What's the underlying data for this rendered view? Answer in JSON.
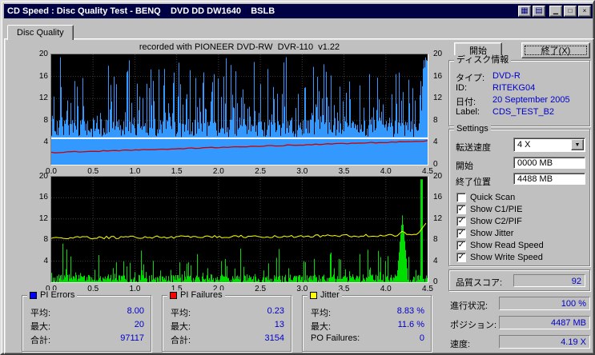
{
  "window": {
    "title": "CD Speed : Disc Quality Test - BENQ    DVD DD DW1640    BSLB",
    "titlebar_buttons": [
      {
        "name": "chart-window-icon-button",
        "glyph": "▦"
      },
      {
        "name": "disc-window-icon-button",
        "glyph": "▤"
      },
      {
        "name": "minimize-button",
        "glyph": "▁"
      },
      {
        "name": "maximize-button",
        "glyph": "□"
      },
      {
        "name": "close-button",
        "glyph": "×"
      }
    ]
  },
  "colors": {
    "titlebar": "#000045",
    "value_text": "#0000C8",
    "window_bg": "#C0C0C0"
  },
  "tab": {
    "label": "Disc Quality"
  },
  "recorded_with": "recorded with PIONEER DVD-RW  DVR-110  v1.22",
  "buttons": {
    "start": "開始",
    "exit": "終了(X)"
  },
  "disc_info": {
    "title": "ディスク情報",
    "rows": [
      {
        "label": "タイプ:",
        "value": "DVD-R"
      },
      {
        "label": "ID:",
        "value": "RITEKG04"
      },
      {
        "label": "日付:",
        "value": "20 September 2005"
      },
      {
        "label": "Label:",
        "value": "CDS_TEST_B2"
      }
    ]
  },
  "settings": {
    "title": "Settings",
    "fields": [
      {
        "label": "転送速度",
        "value": "4 X",
        "type": "dropdown"
      },
      {
        "label": "開始",
        "value": "0000 MB",
        "type": "text"
      },
      {
        "label": "終了位置",
        "value": "4488 MB",
        "type": "text"
      }
    ],
    "checkboxes": [
      {
        "label": "Quick Scan",
        "checked": false
      },
      {
        "label": "Show C1/PIE",
        "checked": true
      },
      {
        "label": "Show C2/PIF",
        "checked": true
      },
      {
        "label": "Show Jitter",
        "checked": true
      },
      {
        "label": "Show Read Speed",
        "checked": true
      },
      {
        "label": "Show Write Speed",
        "checked": true
      }
    ]
  },
  "quality_score": {
    "label": "品質スコア:",
    "value": "92"
  },
  "status_rows": [
    {
      "label": "進行状況:",
      "value": "100 %"
    },
    {
      "label": "ポジション:",
      "value": "4487 MB"
    },
    {
      "label": "速度:",
      "value": "4.19 X"
    }
  ],
  "legends": [
    {
      "title": "PI Errors",
      "color": "#0000ff",
      "rows": [
        {
          "label": "平均:",
          "value": "8.00"
        },
        {
          "label": "最大:",
          "value": "20"
        },
        {
          "label": "合計:",
          "value": "97117"
        }
      ]
    },
    {
      "title": "PI Failures",
      "color": "#ff0000",
      "rows": [
        {
          "label": "平均:",
          "value": "0.23"
        },
        {
          "label": "最大:",
          "value": "13"
        },
        {
          "label": "合計:",
          "value": "3154"
        }
      ]
    },
    {
      "title": "Jitter",
      "color": "#ffff00",
      "rows": [
        {
          "label": "平均:",
          "value": "8.83 %"
        },
        {
          "label": "最大:",
          "value": "11.6 %"
        },
        {
          "label": "PO Failures:",
          "value": "0"
        }
      ]
    }
  ],
  "seed": 20050920,
  "chart_data": [
    {
      "type": "area",
      "name": "pi-errors-scan",
      "background": "#000000",
      "grid": true,
      "x_range": [
        0,
        4.5
      ],
      "y_range": [
        0,
        20
      ],
      "x_ticks": [
        "0.0",
        "0.5",
        "1.0",
        "1.5",
        "2.0",
        "2.5",
        "3.0",
        "3.5",
        "4.0",
        "4.5"
      ],
      "y_ticks_left": [
        "20",
        "16",
        "12",
        "8",
        "4"
      ],
      "y_ticks_right": [
        "20",
        "16",
        "12",
        "8",
        "4",
        "0"
      ],
      "series": [
        {
          "name": "PI Errors (C1/PIE)",
          "style": "area-spikes",
          "color": "#3399ff",
          "avg": 8.0,
          "max": 20
        },
        {
          "name": "Write Speed",
          "style": "line",
          "color": "#ffffff",
          "start": 4.8,
          "end": 4.8
        },
        {
          "name": "Read Speed",
          "style": "line",
          "color": "#cc0000",
          "start": 2.2,
          "end": 4.3
        }
      ]
    },
    {
      "type": "spikes",
      "name": "pi-failures-jitter-scan",
      "background": "#000000",
      "grid": true,
      "x_range": [
        0,
        4.5
      ],
      "y_range": [
        0,
        20
      ],
      "x_ticks": [
        "0.0",
        "0.5",
        "1.0",
        "1.5",
        "2.0",
        "2.5",
        "3.0",
        "3.5",
        "4.0",
        "4.5"
      ],
      "y_ticks_left": [
        "20",
        "16",
        "12",
        "8",
        "4"
      ],
      "y_ticks_right": [
        "20",
        "16",
        "12",
        "8",
        "4",
        "0"
      ],
      "series": [
        {
          "name": "PI Failures (C2/PIF)",
          "style": "spikes",
          "color": "#00dd00",
          "avg": 0.23,
          "max": 13,
          "peak_x": 4.2
        },
        {
          "name": "Jitter",
          "style": "line",
          "color": "#ffff00",
          "avg": 8.83,
          "max": 11.6
        }
      ]
    }
  ]
}
